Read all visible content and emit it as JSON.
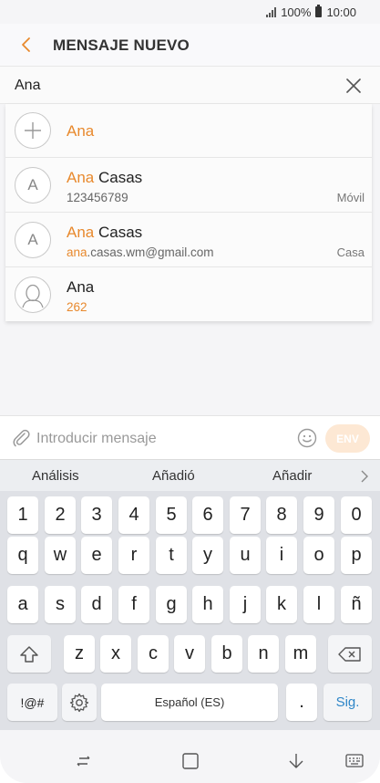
{
  "status_bar": {
    "battery_percent": "100%",
    "time": "10:00"
  },
  "header": {
    "title": "MENSAJE NUEVO"
  },
  "recipient": {
    "value": "Ana"
  },
  "suggestions": [
    {
      "avatar": "+",
      "name_hl": "Ana",
      "name_rest": ""
    },
    {
      "avatar": "A",
      "name_hl": "Ana",
      "name_rest": " Casas",
      "sub_hl": "",
      "sub_rest": "123456789",
      "type": "Móvil"
    },
    {
      "avatar": "A",
      "name_hl": "Ana",
      "name_rest": " Casas",
      "sub_hl": "ana",
      "sub_rest": ".casas.wm@gmail.com",
      "type": "Casa"
    },
    {
      "avatar": "person-icon",
      "name_hl": "",
      "name_rest": "Ana",
      "sub": "262"
    }
  ],
  "compose": {
    "placeholder": "Introducir mensaje",
    "send_label": "ENV"
  },
  "predictions": [
    "Análisis",
    "Añadió",
    "Añadir"
  ],
  "keyboard": {
    "row1": [
      "1",
      "2",
      "3",
      "4",
      "5",
      "6",
      "7",
      "8",
      "9",
      "0"
    ],
    "row2": [
      "q",
      "w",
      "e",
      "r",
      "t",
      "y",
      "u",
      "i",
      "o",
      "p"
    ],
    "row3": [
      "a",
      "s",
      "d",
      "f",
      "g",
      "h",
      "j",
      "k",
      "l",
      "ñ"
    ],
    "row4": [
      "z",
      "x",
      "c",
      "v",
      "b",
      "n",
      "m"
    ],
    "symbols_label": "!@#",
    "space_label": "Español (ES)",
    "period_label": ".",
    "next_label": "Sig."
  },
  "colors": {
    "accent": "#e8892d",
    "send_disabled": "#fde8d4",
    "next_key": "#2e86c8"
  }
}
